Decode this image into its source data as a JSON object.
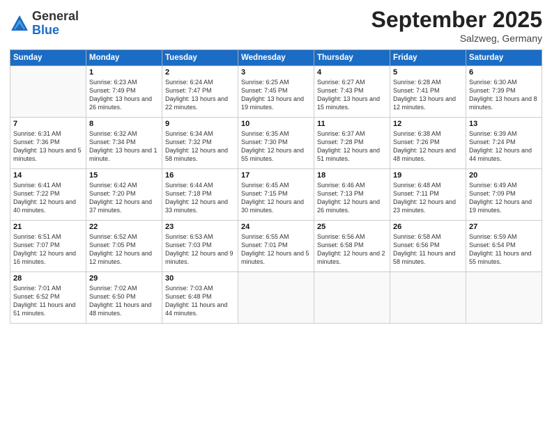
{
  "header": {
    "logo_general": "General",
    "logo_blue": "Blue",
    "month_title": "September 2025",
    "location": "Salzweg, Germany"
  },
  "days_of_week": [
    "Sunday",
    "Monday",
    "Tuesday",
    "Wednesday",
    "Thursday",
    "Friday",
    "Saturday"
  ],
  "weeks": [
    [
      {
        "day": "",
        "info": ""
      },
      {
        "day": "1",
        "info": "Sunrise: 6:23 AM\nSunset: 7:49 PM\nDaylight: 13 hours and 26 minutes."
      },
      {
        "day": "2",
        "info": "Sunrise: 6:24 AM\nSunset: 7:47 PM\nDaylight: 13 hours and 22 minutes."
      },
      {
        "day": "3",
        "info": "Sunrise: 6:25 AM\nSunset: 7:45 PM\nDaylight: 13 hours and 19 minutes."
      },
      {
        "day": "4",
        "info": "Sunrise: 6:27 AM\nSunset: 7:43 PM\nDaylight: 13 hours and 15 minutes."
      },
      {
        "day": "5",
        "info": "Sunrise: 6:28 AM\nSunset: 7:41 PM\nDaylight: 13 hours and 12 minutes."
      },
      {
        "day": "6",
        "info": "Sunrise: 6:30 AM\nSunset: 7:39 PM\nDaylight: 13 hours and 8 minutes."
      }
    ],
    [
      {
        "day": "7",
        "info": "Sunrise: 6:31 AM\nSunset: 7:36 PM\nDaylight: 13 hours and 5 minutes."
      },
      {
        "day": "8",
        "info": "Sunrise: 6:32 AM\nSunset: 7:34 PM\nDaylight: 13 hours and 1 minute."
      },
      {
        "day": "9",
        "info": "Sunrise: 6:34 AM\nSunset: 7:32 PM\nDaylight: 12 hours and 58 minutes."
      },
      {
        "day": "10",
        "info": "Sunrise: 6:35 AM\nSunset: 7:30 PM\nDaylight: 12 hours and 55 minutes."
      },
      {
        "day": "11",
        "info": "Sunrise: 6:37 AM\nSunset: 7:28 PM\nDaylight: 12 hours and 51 minutes."
      },
      {
        "day": "12",
        "info": "Sunrise: 6:38 AM\nSunset: 7:26 PM\nDaylight: 12 hours and 48 minutes."
      },
      {
        "day": "13",
        "info": "Sunrise: 6:39 AM\nSunset: 7:24 PM\nDaylight: 12 hours and 44 minutes."
      }
    ],
    [
      {
        "day": "14",
        "info": "Sunrise: 6:41 AM\nSunset: 7:22 PM\nDaylight: 12 hours and 40 minutes."
      },
      {
        "day": "15",
        "info": "Sunrise: 6:42 AM\nSunset: 7:20 PM\nDaylight: 12 hours and 37 minutes."
      },
      {
        "day": "16",
        "info": "Sunrise: 6:44 AM\nSunset: 7:18 PM\nDaylight: 12 hours and 33 minutes."
      },
      {
        "day": "17",
        "info": "Sunrise: 6:45 AM\nSunset: 7:15 PM\nDaylight: 12 hours and 30 minutes."
      },
      {
        "day": "18",
        "info": "Sunrise: 6:46 AM\nSunset: 7:13 PM\nDaylight: 12 hours and 26 minutes."
      },
      {
        "day": "19",
        "info": "Sunrise: 6:48 AM\nSunset: 7:11 PM\nDaylight: 12 hours and 23 minutes."
      },
      {
        "day": "20",
        "info": "Sunrise: 6:49 AM\nSunset: 7:09 PM\nDaylight: 12 hours and 19 minutes."
      }
    ],
    [
      {
        "day": "21",
        "info": "Sunrise: 6:51 AM\nSunset: 7:07 PM\nDaylight: 12 hours and 16 minutes."
      },
      {
        "day": "22",
        "info": "Sunrise: 6:52 AM\nSunset: 7:05 PM\nDaylight: 12 hours and 12 minutes."
      },
      {
        "day": "23",
        "info": "Sunrise: 6:53 AM\nSunset: 7:03 PM\nDaylight: 12 hours and 9 minutes."
      },
      {
        "day": "24",
        "info": "Sunrise: 6:55 AM\nSunset: 7:01 PM\nDaylight: 12 hours and 5 minutes."
      },
      {
        "day": "25",
        "info": "Sunrise: 6:56 AM\nSunset: 6:58 PM\nDaylight: 12 hours and 2 minutes."
      },
      {
        "day": "26",
        "info": "Sunrise: 6:58 AM\nSunset: 6:56 PM\nDaylight: 11 hours and 58 minutes."
      },
      {
        "day": "27",
        "info": "Sunrise: 6:59 AM\nSunset: 6:54 PM\nDaylight: 11 hours and 55 minutes."
      }
    ],
    [
      {
        "day": "28",
        "info": "Sunrise: 7:01 AM\nSunset: 6:52 PM\nDaylight: 11 hours and 51 minutes."
      },
      {
        "day": "29",
        "info": "Sunrise: 7:02 AM\nSunset: 6:50 PM\nDaylight: 11 hours and 48 minutes."
      },
      {
        "day": "30",
        "info": "Sunrise: 7:03 AM\nSunset: 6:48 PM\nDaylight: 11 hours and 44 minutes."
      },
      {
        "day": "",
        "info": ""
      },
      {
        "day": "",
        "info": ""
      },
      {
        "day": "",
        "info": ""
      },
      {
        "day": "",
        "info": ""
      }
    ]
  ]
}
